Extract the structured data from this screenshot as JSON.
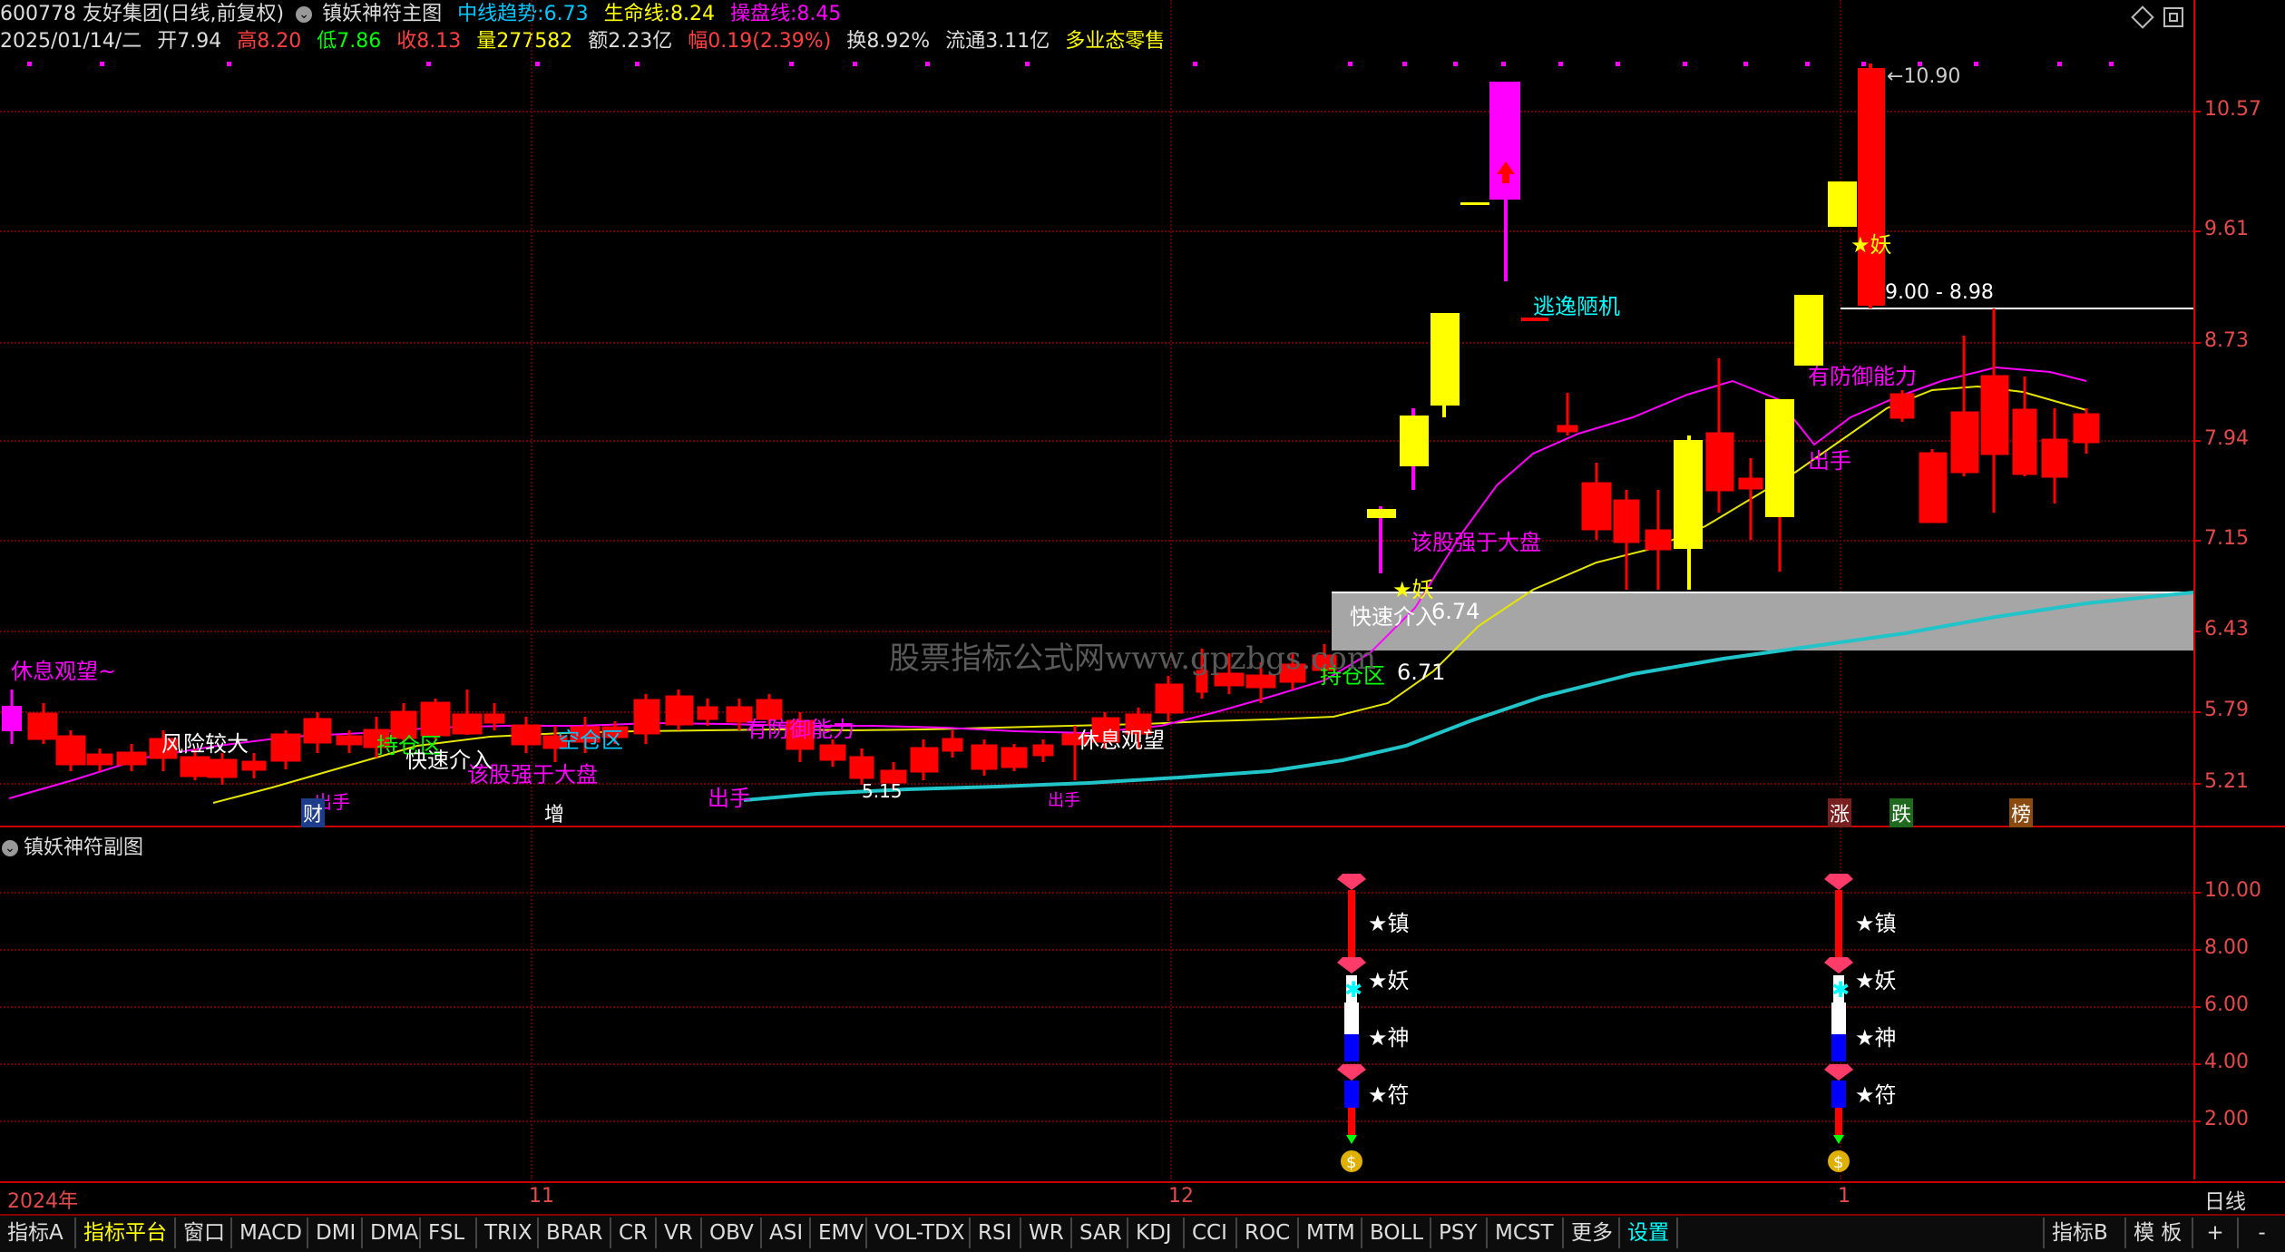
{
  "header": {
    "symbol_title": "600778 友好集团(日线,前复权)",
    "indicator_main": "镇妖神符主图",
    "mid_trend_label": "中线趋势:",
    "mid_trend_value": "6.73",
    "life_line_label": "生命线:",
    "life_line_value": "8.24",
    "op_line_label": "操盘线:",
    "op_line_value": "8.45"
  },
  "quote": {
    "date": "2025/01/14/二",
    "open_label": "开",
    "open": "7.94",
    "high_label": "高",
    "high": "8.20",
    "low_label": "低",
    "low": "7.86",
    "close_label": "收",
    "close": "8.13",
    "vol_label": "量",
    "vol": "277582",
    "amount_label": "额",
    "amount": "2.23亿",
    "amp_label": "幅",
    "amp": "0.19(2.39%)",
    "turnover_label": "换",
    "turnover": "8.92%",
    "float_label": "流通",
    "float": "3.11亿",
    "sector": "多业态零售"
  },
  "main_axis": [
    "10.57",
    "9.61",
    "8.73",
    "7.94",
    "7.15",
    "6.43",
    "5.79",
    "5.21"
  ],
  "sub_axis": [
    "10.00",
    "8.00",
    "6.00",
    "4.00",
    "2.00"
  ],
  "x_axis": [
    "2024年",
    "11",
    "12",
    "1"
  ],
  "annotations": {
    "rest": "休息观望~",
    "risk": "风险较大",
    "hold_zone": "持仓区",
    "fast_in": "快速介入",
    "stronger": "该股强于大盘",
    "empty_zone": "空仓区",
    "defense": "有防御能力",
    "sell": "出手",
    "sell2": "出手",
    "sell3": "出手",
    "rest2": "休息观望",
    "cai": "财",
    "zeng": "增",
    "low_mark": "5.15",
    "fast_in2": "快速介入",
    "v674": "6.74",
    "hold_zone2": "持仓区",
    "v671": "6.71",
    "yao": "妖",
    "stronger2": "该股强于大盘",
    "top_opportunity": "逃逸陋机",
    "top_price": "10.90",
    "range": "9.00 - 8.98",
    "defense2": "有防御能力",
    "sell4": "出手",
    "yao2": "妖",
    "zhang": "涨",
    "die": "跌",
    "bang": "榜",
    "watermark": "股票指标公式网www.gpzbgs.com"
  },
  "sub_chart": {
    "title": "镇妖神符副图",
    "marks": [
      "★镇",
      "★妖",
      "★神",
      "★符"
    ]
  },
  "right_panel": {
    "period": "日线",
    "plus": "+",
    "minus": "-"
  },
  "tabs": [
    "指标A",
    "指标平台",
    "窗口",
    "MACD",
    "DMI",
    "DMA",
    "FSL",
    "TRIX",
    "BRAR",
    "CR",
    "VR",
    "OBV",
    "ASI",
    "EMV",
    "VOL-TDX",
    "RSI",
    "WR",
    "SAR",
    "KDJ",
    "CCI",
    "ROC",
    "MTM",
    "BOLL",
    "PSY",
    "MCST",
    "更多",
    "设置"
  ],
  "tabs_right": [
    "指标B",
    "模 板"
  ],
  "colors": {
    "up": "#ff0000",
    "down_cyan": "#00ffff",
    "yellow": "#ffff00",
    "magenta": "#ff00ff",
    "teal": "#21c4c8",
    "axis_red": "#e34a4a"
  }
}
